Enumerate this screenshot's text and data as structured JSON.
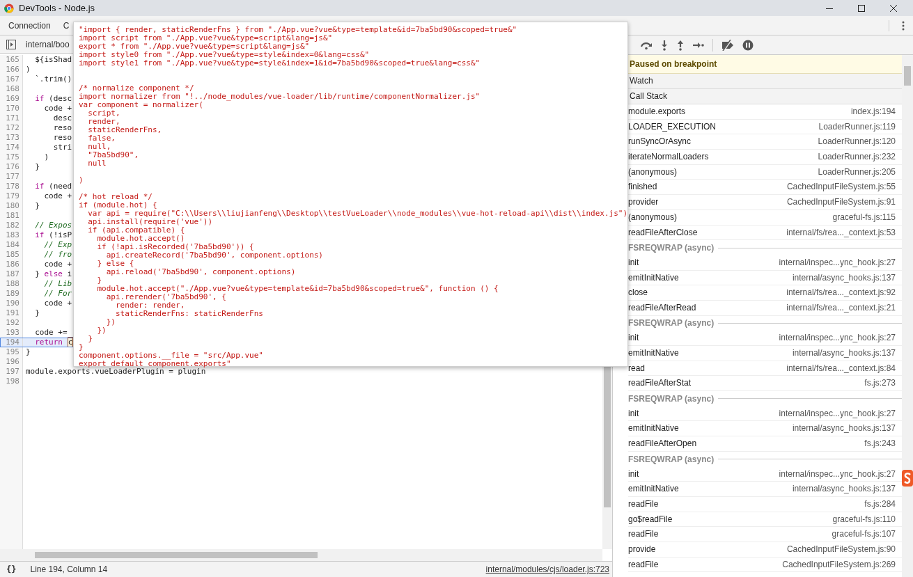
{
  "window": {
    "title": "DevTools - Node.js"
  },
  "tabs": [
    {
      "label": "Connection"
    },
    {
      "label": "C"
    }
  ],
  "editor": {
    "file_tab": "internal/boo",
    "lines": [
      {
        "number": "165",
        "text": "  ${isShad",
        "current": false
      },
      {
        "number": "166",
        "text": ")",
        "current": false
      },
      {
        "number": "167",
        "text": "  `.trim()",
        "current": false
      },
      {
        "number": "168",
        "current": false
      },
      {
        "number": "169",
        "text": "  if (desc",
        "current": false
      },
      {
        "number": "170",
        "text": "    code +",
        "current": false
      },
      {
        "number": "171",
        "text": "      desc",
        "current": false
      },
      {
        "number": "172",
        "text": "      reso",
        "current": false
      },
      {
        "number": "173",
        "text": "      reso",
        "current": false
      },
      {
        "number": "174",
        "text": "      stri",
        "current": false
      },
      {
        "number": "175",
        "text": "    )",
        "current": false
      },
      {
        "number": "176",
        "text": "  }",
        "current": false
      },
      {
        "number": "177",
        "current": false
      },
      {
        "number": "178",
        "text": "  if (need",
        "current": false
      },
      {
        "number": "179",
        "text": "    code +",
        "current": false
      },
      {
        "number": "180",
        "text": "  }",
        "current": false
      },
      {
        "number": "181",
        "current": false
      },
      {
        "number": "182",
        "text": "  // Expos",
        "current": false
      },
      {
        "number": "183",
        "text": "  if (!isP",
        "current": false
      },
      {
        "number": "184",
        "text": "    // Exp",
        "current": false
      },
      {
        "number": "185",
        "text": "    // fro",
        "current": false
      },
      {
        "number": "186",
        "text": "    code +",
        "current": false
      },
      {
        "number": "187",
        "text": "  } else i",
        "current": false
      },
      {
        "number": "188",
        "text": "    // Lib",
        "current": false
      },
      {
        "number": "189",
        "text": "    // For",
        "current": false
      },
      {
        "number": "190",
        "text": "    code +",
        "current": false
      },
      {
        "number": "191",
        "text": "  }",
        "current": false
      },
      {
        "number": "192",
        "current": false
      },
      {
        "number": "193",
        "text": "  code +=",
        "current": false
      },
      {
        "number": "194",
        "text": "  return c",
        "current": true
      },
      {
        "number": "195",
        "text": "}",
        "current": false
      },
      {
        "number": "196",
        "current": false
      },
      {
        "number": "197",
        "text": "module.exports.vueLoaderPlugin = plugin",
        "current": false
      },
      {
        "number": "198",
        "current": false
      }
    ]
  },
  "popup": {
    "text": "\"import { render, staticRenderFns } from \"./App.vue?vue&type=template&id=7ba5bd90&scoped=true&\"\nimport script from \"./App.vue?vue&type=script&lang=js&\"\nexport * from \"./App.vue?vue&type=script&lang=js&\"\nimport style0 from \"./App.vue?vue&type=style&index=0&lang=css&\"\nimport style1 from \"./App.vue?vue&type=style&index=1&id=7ba5bd90&scoped=true&lang=css&\"\n\n\n/* normalize component */\nimport normalizer from \"!../node_modules/vue-loader/lib/runtime/componentNormalizer.js\"\nvar component = normalizer(\n  script,\n  render,\n  staticRenderFns,\n  false,\n  null,\n  \"7ba5bd90\",\n  null\n  \n)\n\n/* hot reload */\nif (module.hot) {\n  var api = require(\"C:\\\\Users\\\\liujianfeng\\\\Desktop\\\\testVueLoader\\\\node_modules\\\\vue-hot-reload-api\\\\dist\\\\index.js\")\n  api.install(require('vue'))\n  if (api.compatible) {\n    module.hot.accept()\n    if (!api.isRecorded('7ba5bd90')) {\n      api.createRecord('7ba5bd90', component.options)\n    } else {\n      api.reload('7ba5bd90', component.options)\n    }\n    module.hot.accept(\"./App.vue?vue&type=template&id=7ba5bd90&scoped=true&\", function () {\n      api.rerender('7ba5bd90', {\n        render: render,\n        staticRenderFns: staticRenderFns\n      })\n    })\n  }\n}\ncomponent.options.__file = \"src/App.vue\"\nexport default component.exports\""
  },
  "status_bar": {
    "pretty_print": "{}",
    "position": "Line 194, Column 14",
    "source_link": "internal/modules/cjs/loader.js:723"
  },
  "sidebar": {
    "paused_message": "Paused on breakpoint",
    "sections": [
      "Watch",
      "Call Stack"
    ],
    "call_stack": [
      {
        "kind": "frame",
        "name": "module.exports",
        "location": "index.js:194"
      },
      {
        "kind": "frame",
        "name": "LOADER_EXECUTION",
        "location": "LoaderRunner.js:119"
      },
      {
        "kind": "frame",
        "name": "runSyncOrAsync",
        "location": "LoaderRunner.js:120"
      },
      {
        "kind": "frame",
        "name": "iterateNormalLoaders",
        "location": "LoaderRunner.js:232"
      },
      {
        "kind": "frame",
        "name": "(anonymous)",
        "location": "LoaderRunner.js:205"
      },
      {
        "kind": "frame",
        "name": "finished",
        "location": "CachedInputFileSystem.js:55"
      },
      {
        "kind": "frame",
        "name": "provider",
        "location": "CachedInputFileSystem.js:91"
      },
      {
        "kind": "frame",
        "name": "(anonymous)",
        "location": "graceful-fs.js:115"
      },
      {
        "kind": "frame",
        "name": "readFileAfterClose",
        "location": "internal/fs/rea..._context.js:53"
      },
      {
        "kind": "async",
        "name": "FSREQWRAP (async)"
      },
      {
        "kind": "frame",
        "name": "init",
        "location": "internal/inspec...ync_hook.js:27"
      },
      {
        "kind": "frame",
        "name": "emitInitNative",
        "location": "internal/async_hooks.js:137"
      },
      {
        "kind": "frame",
        "name": "close",
        "location": "internal/fs/rea..._context.js:92"
      },
      {
        "kind": "frame",
        "name": "readFileAfterRead",
        "location": "internal/fs/rea..._context.js:21"
      },
      {
        "kind": "async",
        "name": "FSREQWRAP (async)"
      },
      {
        "kind": "frame",
        "name": "init",
        "location": "internal/inspec...ync_hook.js:27"
      },
      {
        "kind": "frame",
        "name": "emitInitNative",
        "location": "internal/async_hooks.js:137"
      },
      {
        "kind": "frame",
        "name": "read",
        "location": "internal/fs/rea..._context.js:84"
      },
      {
        "kind": "frame",
        "name": "readFileAfterStat",
        "location": "fs.js:273"
      },
      {
        "kind": "async",
        "name": "FSREQWRAP (async)"
      },
      {
        "kind": "frame",
        "name": "init",
        "location": "internal/inspec...ync_hook.js:27"
      },
      {
        "kind": "frame",
        "name": "emitInitNative",
        "location": "internal/async_hooks.js:137"
      },
      {
        "kind": "frame",
        "name": "readFileAfterOpen",
        "location": "fs.js:243"
      },
      {
        "kind": "async",
        "name": "FSREQWRAP (async)"
      },
      {
        "kind": "frame",
        "name": "init",
        "location": "internal/inspec...ync_hook.js:27"
      },
      {
        "kind": "frame",
        "name": "emitInitNative",
        "location": "internal/async_hooks.js:137"
      },
      {
        "kind": "frame",
        "name": "readFile",
        "location": "fs.js:284"
      },
      {
        "kind": "frame",
        "name": "go$readFile",
        "location": "graceful-fs.js:110"
      },
      {
        "kind": "frame",
        "name": "readFile",
        "location": "graceful-fs.js:107"
      },
      {
        "kind": "frame",
        "name": "provide",
        "location": "CachedInputFileSystem.js:90"
      },
      {
        "kind": "frame",
        "name": "readFile",
        "location": "CachedInputFileSystem.js:269"
      }
    ]
  }
}
